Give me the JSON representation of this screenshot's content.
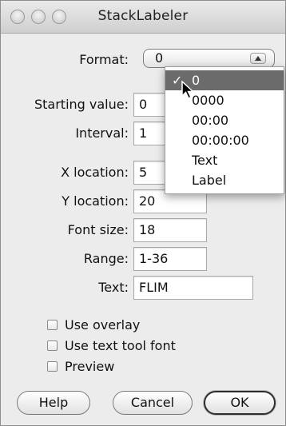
{
  "window": {
    "title": "StackLabeler"
  },
  "form": {
    "format_label": "Format:",
    "format_value": "0",
    "starting_value_label": "Starting value:",
    "starting_value": "0",
    "interval_label": "Interval:",
    "interval": "1",
    "x_location_label": "X location:",
    "x_location": "5",
    "y_location_label": "Y location:",
    "y_location": "20",
    "font_size_label": "Font size:",
    "font_size": "18",
    "range_label": "Range:",
    "range": "1-36",
    "text_label": "Text:",
    "text": "FLIM"
  },
  "format_menu": {
    "items": [
      "0",
      "0000",
      "00:00",
      "00:00:00",
      "Text",
      "Label"
    ],
    "selected_index": 0,
    "check_mark": "✓"
  },
  "checkboxes": [
    {
      "label": "Use overlay",
      "checked": false
    },
    {
      "label": "Use text tool font",
      "checked": false
    },
    {
      "label": "Preview",
      "checked": false
    }
  ],
  "buttons": {
    "help": "Help",
    "cancel": "Cancel",
    "ok": "OK"
  }
}
